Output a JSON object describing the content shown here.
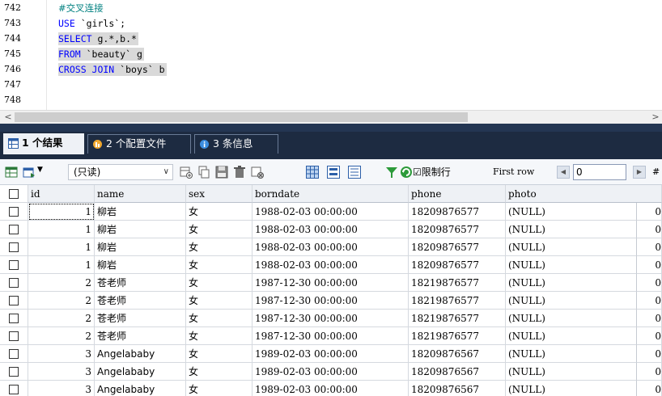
{
  "editor": {
    "line_numbers": [
      "742",
      "743",
      "744",
      "745",
      "746",
      "747",
      "748"
    ],
    "code": {
      "comment": "#交叉连接",
      "use_kw": "USE",
      "use_rest": " `girls`;",
      "select_kw": "SELECT",
      "select_rest": " g.*,b.*",
      "from_kw": "FROM",
      "from_rest": " `beauty` g",
      "cross_kw": "CROSS JOIN",
      "cross_rest": " `boys` b"
    },
    "scroll_left": "<",
    "scroll_right": ">"
  },
  "tabs": [
    {
      "label": "1 个结果",
      "icon": "table-icon"
    },
    {
      "label": "2 个配置文件",
      "icon": "profile-icon"
    },
    {
      "label": "3 条信息",
      "icon": "info-icon"
    }
  ],
  "toolbar": {
    "readonly_label": "(只读)",
    "limit_label": "☑限制行",
    "first_row_label": "First row",
    "first_row_value": "0",
    "rows_label": "#"
  },
  "grid": {
    "columns": [
      "id",
      "name",
      "sex",
      "borndate",
      "phone",
      "photo"
    ],
    "rows": [
      {
        "id": "1",
        "name": "柳岩",
        "sex": "女",
        "borndate": "1988-02-03 00:00:00",
        "phone": "18209876577",
        "photo": "(NULL)",
        "extra": "0"
      },
      {
        "id": "1",
        "name": "柳岩",
        "sex": "女",
        "borndate": "1988-02-03 00:00:00",
        "phone": "18209876577",
        "photo": "(NULL)",
        "extra": "0"
      },
      {
        "id": "1",
        "name": "柳岩",
        "sex": "女",
        "borndate": "1988-02-03 00:00:00",
        "phone": "18209876577",
        "photo": "(NULL)",
        "extra": "0"
      },
      {
        "id": "1",
        "name": "柳岩",
        "sex": "女",
        "borndate": "1988-02-03 00:00:00",
        "phone": "18209876577",
        "photo": "(NULL)",
        "extra": "0"
      },
      {
        "id": "2",
        "name": "苍老师",
        "sex": "女",
        "borndate": "1987-12-30 00:00:00",
        "phone": "18219876577",
        "photo": "(NULL)",
        "extra": "0"
      },
      {
        "id": "2",
        "name": "苍老师",
        "sex": "女",
        "borndate": "1987-12-30 00:00:00",
        "phone": "18219876577",
        "photo": "(NULL)",
        "extra": "0"
      },
      {
        "id": "2",
        "name": "苍老师",
        "sex": "女",
        "borndate": "1987-12-30 00:00:00",
        "phone": "18219876577",
        "photo": "(NULL)",
        "extra": "0"
      },
      {
        "id": "2",
        "name": "苍老师",
        "sex": "女",
        "borndate": "1987-12-30 00:00:00",
        "phone": "18219876577",
        "photo": "(NULL)",
        "extra": "0"
      },
      {
        "id": "3",
        "name": "Angelababy",
        "sex": "女",
        "borndate": "1989-02-03 00:00:00",
        "phone": "18209876567",
        "photo": "(NULL)",
        "extra": "0"
      },
      {
        "id": "3",
        "name": "Angelababy",
        "sex": "女",
        "borndate": "1989-02-03 00:00:00",
        "phone": "18209876567",
        "photo": "(NULL)",
        "extra": "0"
      },
      {
        "id": "3",
        "name": "Angelababy",
        "sex": "女",
        "borndate": "1989-02-03 00:00:00",
        "phone": "18209876567",
        "photo": "(NULL)",
        "extra": "0"
      }
    ]
  },
  "colors": {
    "keyword": "#0000ff",
    "comment": "#008080",
    "tab_bar": "#1d2b41",
    "selection": "#d9d9d9"
  }
}
